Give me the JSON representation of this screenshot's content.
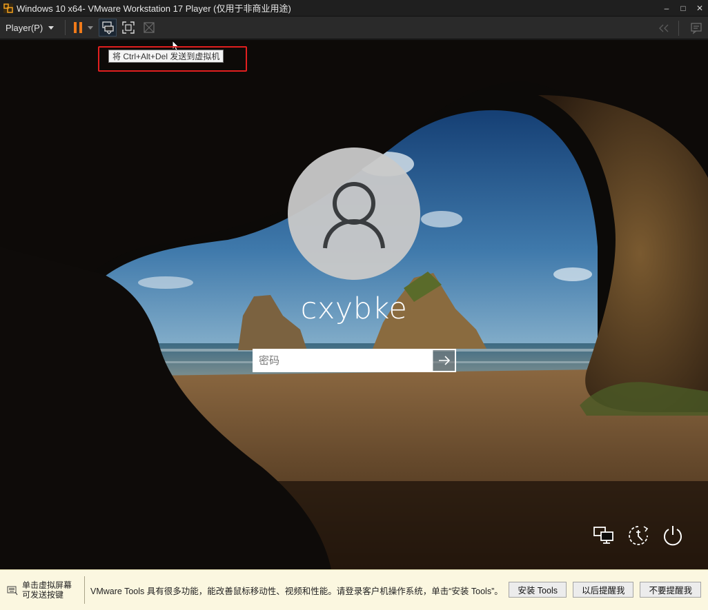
{
  "window": {
    "title": "Windows 10 x64- VMware Workstation 17 Player (仅用于非商业用途)",
    "minimize": "–",
    "maximize": "□",
    "close": "✕"
  },
  "toolbar": {
    "player_menu": "Player(P)",
    "tooltip": "将 Ctrl+Alt+Del 发送到虚拟机"
  },
  "icons": {
    "app": "vmware-logo-icon",
    "pause": "pause-icon",
    "send_cad": "send-ctrl-alt-del-icon",
    "fullscreen": "fullscreen-icon",
    "unity": "unity-icon",
    "collapse": "double-chevron-left-icon",
    "message_log": "message-log-icon",
    "network": "network-icon",
    "ease_of_access": "ease-of-access-icon",
    "power": "power-icon",
    "submit": "arrow-right-icon",
    "keyboard": "keyboard-icon"
  },
  "login": {
    "username": "cxybke",
    "password_placeholder": "密码",
    "password_value": ""
  },
  "infobar": {
    "hint_line1": "单击虚拟屏幕",
    "hint_line2": "可发送按键",
    "message": "VMware Tools 具有很多功能，能改善鼠标移动性、视频和性能。请登录客户机操作系统，单击“安装 Tools”。",
    "buttons": [
      "安装 Tools",
      "以后提醒我",
      "不要提醒我"
    ]
  },
  "colors": {
    "pause_accent": "#f07a1a",
    "highlight_box": "#e21f1f",
    "infobar_bg": "#fbf7e0"
  }
}
